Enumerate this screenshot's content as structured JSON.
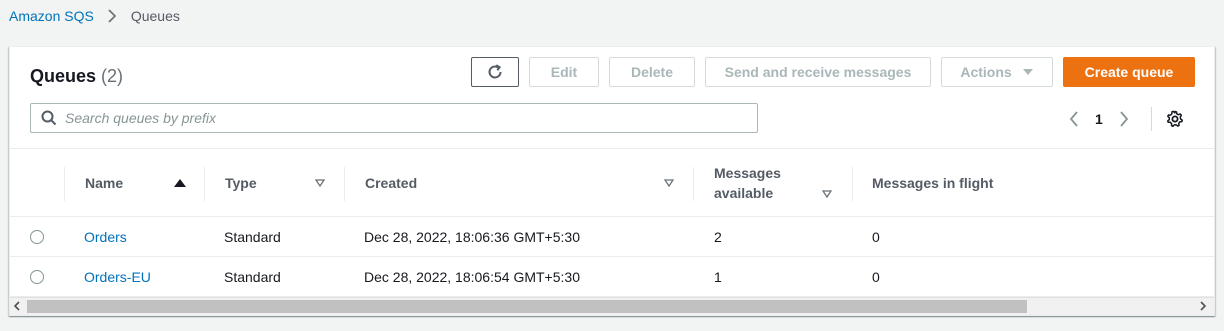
{
  "breadcrumb": {
    "root": "Amazon SQS",
    "current": "Queues"
  },
  "panel": {
    "title": "Queues",
    "count": "(2)"
  },
  "toolbar": {
    "refresh_icon": "refresh-icon",
    "edit_label": "Edit",
    "delete_label": "Delete",
    "send_receive_label": "Send and receive messages",
    "actions_label": "Actions",
    "create_label": "Create queue"
  },
  "search": {
    "placeholder": "Search queues by prefix",
    "value": ""
  },
  "pagination": {
    "current_page": "1"
  },
  "table": {
    "columns": {
      "name": "Name",
      "type": "Type",
      "created": "Created",
      "messages_available_line1": "Messages",
      "messages_available_line2": "available",
      "messages_in_flight": "Messages in flight"
    },
    "rows": [
      {
        "name": "Orders",
        "type": "Standard",
        "created": "Dec 28, 2022, 18:06:36 GMT+5:30",
        "messages_available": "2",
        "messages_in_flight": "0"
      },
      {
        "name": "Orders-EU",
        "type": "Standard",
        "created": "Dec 28, 2022, 18:06:54 GMT+5:30",
        "messages_available": "1",
        "messages_in_flight": "0"
      }
    ]
  },
  "colors": {
    "link": "#0073bb",
    "primary_button": "#ec7211",
    "page_background": "#f2f3f3"
  }
}
